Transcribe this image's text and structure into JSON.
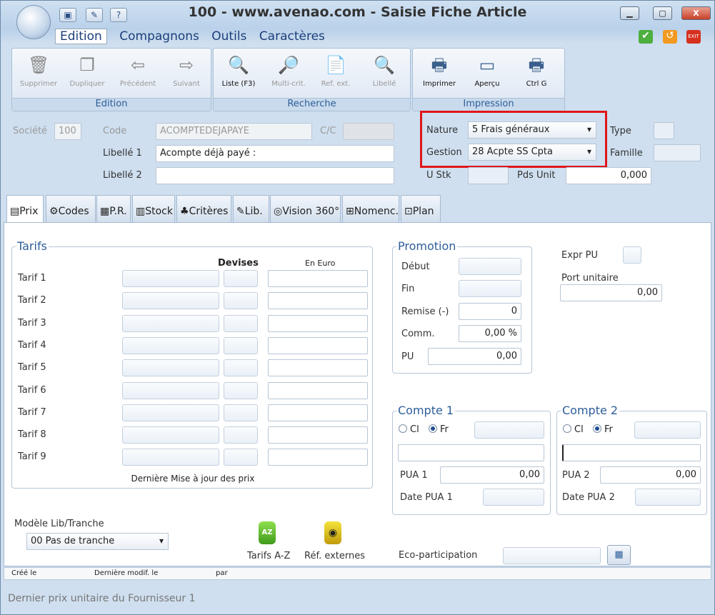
{
  "window": {
    "title": "100 - www.avenao.com - Saisie Fiche Article",
    "minimize": "▁",
    "maximize": "▢",
    "close": "X"
  },
  "menu": {
    "items": [
      "Edition",
      "Compagnons",
      "Outils",
      "Caractères"
    ],
    "selected": "Edition"
  },
  "ribbon": {
    "edition": {
      "label": "Edition",
      "buttons": [
        "Supprimer",
        "Dupliquer",
        "Précédent",
        "Suivant"
      ]
    },
    "recherche": {
      "label": "Recherche",
      "buttons": [
        "Liste (F3)",
        "Multi-crit.",
        "Ref. ext.",
        "Libellé"
      ]
    },
    "impression": {
      "label": "Impression",
      "buttons": [
        "Imprimer",
        "Aperçu",
        "Ctrl G"
      ]
    }
  },
  "header": {
    "societe_label": "Société",
    "societe_value": "100",
    "code_label": "Code",
    "code_value": "ACOMPTEDEJAPAYE",
    "cc_label": "C/C",
    "libelle1_label": "Libellé 1",
    "libelle1_value": "Acompte déjà payé :",
    "libelle2_label": "Libellé 2",
    "libelle2_value": "",
    "nature_label": "Nature",
    "nature_value": "5  Frais généraux",
    "gestion_label": "Gestion",
    "gestion_value": "28 Acpte SS Cpta",
    "type_label": "Type",
    "famille_label": "Famille",
    "ustk_label": "U Stk",
    "pdsunit_label": "Pds Unit",
    "pdsunit_value": "0,000"
  },
  "tabs": [
    "Prix",
    "Codes",
    "P.R.",
    "Stock",
    "Critères",
    "Lib.",
    "Vision 360°",
    "Nomenc.",
    "Plan"
  ],
  "tarifs": {
    "legend": "Tarifs",
    "devises_header": "Devises",
    "euro_header": "En Euro",
    "rows": [
      "Tarif 1",
      "Tarif 2",
      "Tarif 3",
      "Tarif 4",
      "Tarif 5",
      "Tarif 6",
      "Tarif 7",
      "Tarif 8",
      "Tarif 9"
    ],
    "note": "Dernière Mise à jour des prix"
  },
  "promotion": {
    "legend": "Promotion",
    "debut_label": "Début",
    "fin_label": "Fin",
    "remise_label": "Remise (-)",
    "remise_value": "0",
    "comm_label": "Comm.",
    "comm_value": "0,00 %",
    "pu_label": "PU",
    "pu_value": "0,00"
  },
  "right": {
    "expr_pu_label": "Expr PU",
    "port_label": "Port unitaire",
    "port_value": "0,00"
  },
  "compte1": {
    "legend": "Compte 1",
    "cl": "Cl",
    "fr": "Fr",
    "pua_label": "PUA 1",
    "pua_value": "0,00",
    "date_label": "Date PUA 1"
  },
  "compte2": {
    "legend": "Compte 2",
    "cl": "Cl",
    "fr": "Fr",
    "pua_label": "PUA 2",
    "pua_value": "0,00",
    "date_label": "Date PUA 2"
  },
  "bottom": {
    "modele_label": "Modèle Lib/Tranche",
    "modele_value": "00 Pas de tranche",
    "tarifs_az": "Tarifs A-Z",
    "ref_externes": "Réf. externes",
    "eco_label": "Eco-participation",
    "az_icon": "AZ"
  },
  "status": {
    "cree": "Créé le",
    "modif": "Dernière modif. le",
    "par": "par"
  },
  "footer": "Dernier prix unitaire du Fournisseur 1"
}
